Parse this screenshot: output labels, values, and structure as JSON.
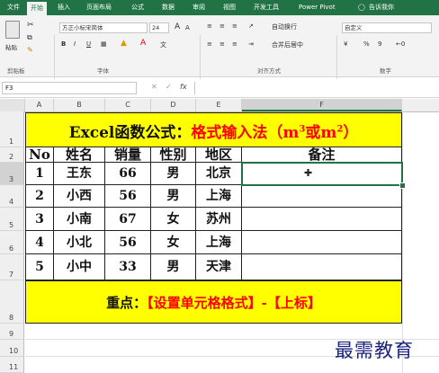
{
  "tabs": [
    "文件",
    "开始",
    "插入",
    "页面布局",
    "公式",
    "数据",
    "审阅",
    "视图",
    "开发工具",
    "Power Pivot",
    "告诉我你"
  ],
  "ribbon": {
    "paste_label": "粘贴",
    "font_name": "方正小标宋简体",
    "font_size": "24",
    "font_grow": "A",
    "font_shrink": "A",
    "bold": "B",
    "italic": "I",
    "underline": "U",
    "wrap_text": "自动换行",
    "merge_center": "合并后居中",
    "number_format": "自定义",
    "percent": "%",
    "comma": "9",
    "groups": [
      "剪贴板",
      "字体",
      "对齐方式",
      "数字"
    ]
  },
  "formula_bar": {
    "name_box": "F3",
    "fx": "fx",
    "value": ""
  },
  "columns": [
    "A",
    "B",
    "C",
    "D",
    "E",
    "F"
  ],
  "rows": [
    "1",
    "2",
    "3",
    "4",
    "5",
    "6",
    "7",
    "8",
    "9",
    "10",
    "11"
  ],
  "sheet": {
    "title_black": "Excel函数公式：",
    "title_red": "格式输入法（m",
    "title_sup1": "3",
    "title_mid": "或m",
    "title_sup2": "2",
    "title_end": "）",
    "headers": [
      "No",
      "姓名",
      "销量",
      "性别",
      "地区",
      "备注"
    ],
    "data": [
      [
        "1",
        "王东",
        "66",
        "男",
        "北京",
        ""
      ],
      [
        "2",
        "小西",
        "56",
        "男",
        "上海",
        ""
      ],
      [
        "3",
        "小南",
        "67",
        "女",
        "苏州",
        ""
      ],
      [
        "4",
        "小北",
        "56",
        "女",
        "上海",
        ""
      ],
      [
        "5",
        "小中",
        "33",
        "男",
        "天津",
        ""
      ]
    ],
    "footer_black": "重点：",
    "footer_red": "【设置单元格格式】-【上标】"
  },
  "watermark": "最需教育",
  "colors": {
    "excel_green": "#217346",
    "highlight": "#ffff00",
    "red_text": "#ff0000"
  }
}
